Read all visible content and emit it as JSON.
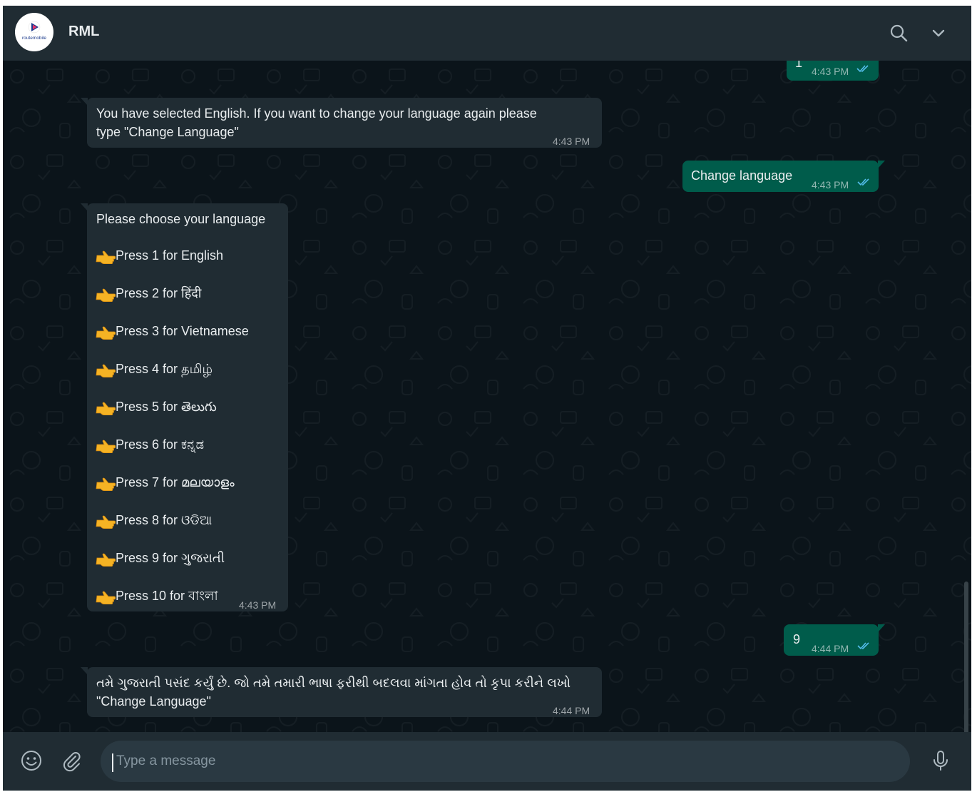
{
  "header": {
    "contact_name": "RML",
    "avatar_icon": "routemobile-logo",
    "avatar_logo_text": "routemobile",
    "search_icon": "search-icon",
    "menu_icon": "chevron-down-icon"
  },
  "messages": [
    {
      "direction": "outgoing",
      "text": "1",
      "time": "4:43 PM",
      "status": "read"
    },
    {
      "direction": "incoming",
      "text_lines": [
        "You have selected English. If you want to change your language again please",
        "type \"Change Language\""
      ],
      "time": "4:43 PM"
    },
    {
      "direction": "outgoing",
      "text": "Change language",
      "time": "4:43 PM",
      "status": "read"
    },
    {
      "direction": "incoming",
      "title": "Please choose your language",
      "options": [
        "Press 1 for English",
        "Press 2 for हिंदी",
        "Press 3 for Vietnamese",
        "Press 4 for தமிழ்",
        "Press 5 for తెలుగు",
        "Press 6 for ಕನ್ನಡ",
        "Press 7 for മലയാളം",
        "Press 8 for ଓଡିଆ",
        "Press 9 for ગુજરાતી",
        "Press 10 for বাংলা"
      ],
      "option_icon": "pointing-hand-emoji",
      "time": "4:43 PM"
    },
    {
      "direction": "outgoing",
      "text": "9",
      "time": "4:44 PM",
      "status": "read"
    },
    {
      "direction": "incoming",
      "text_lines": [
        "તમે ગુજરાતી પસંદ કર્યું છે. જો તમે તમારી ભાષા ફરીથી બદલવા માંગતા હોવ તો કૃપા કરીને લખો",
        "\"Change Language\""
      ],
      "time": "4:44 PM"
    }
  ],
  "composer": {
    "placeholder": "Type a message",
    "value": "",
    "emoji_icon": "smiley-icon",
    "attach_icon": "paperclip-icon",
    "mic_icon": "microphone-icon"
  },
  "colors": {
    "header_bg": "#202c33",
    "chat_bg": "#0b141a",
    "incoming_bubble": "#202c33",
    "outgoing_bubble": "#005c4b",
    "read_tick": "#53bdeb",
    "text": "#e9edef"
  }
}
